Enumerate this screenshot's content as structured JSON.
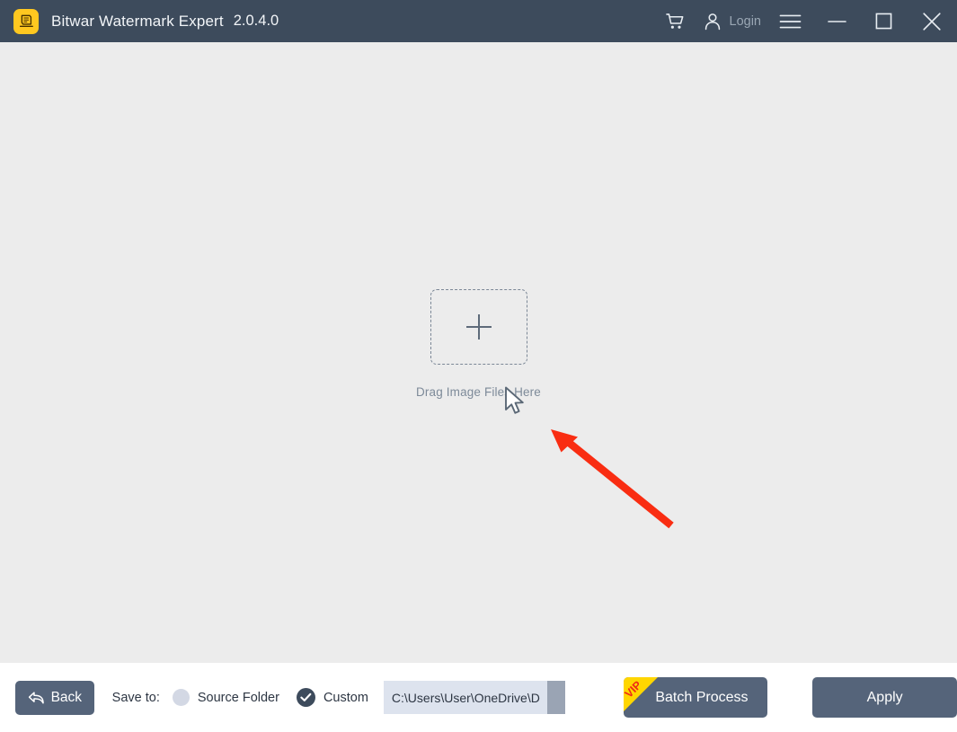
{
  "window": {
    "title": "Bitwar Watermark Expert",
    "version": "2.0.4.0",
    "app_icon": "bitwar-logo-icon"
  },
  "titlebar": {
    "cart_icon": "shopping-cart-icon",
    "account_icon": "user-account-icon",
    "login_label": "Login",
    "menu_icon": "hamburger-menu-icon",
    "minimize_icon": "minimize-icon",
    "maximize_icon": "maximize-icon",
    "close_icon": "close-icon"
  },
  "main": {
    "dropzone": {
      "plus_icon": "plus-icon",
      "label": "Drag Image Files Here"
    },
    "cursor_icon": "mouse-pointer-icon",
    "annotation_arrow_icon": "red-arrow-annotation-icon",
    "annotation_arrow_color": "#f92d12",
    "background_color": "#ececec"
  },
  "bottombar": {
    "back_label": "Back",
    "back_icon": "undo-arrow-icon",
    "save_to_label": "Save to:",
    "options": [
      {
        "label": "Source Folder",
        "selected": false
      },
      {
        "label": "Custom",
        "selected": true
      }
    ],
    "path_value": "C:\\Users\\User\\OneDrive\\D",
    "path_scroll_icon": "scroll-handle-icon",
    "batch_label": "Batch Process",
    "batch_badge": "VIP",
    "apply_label": "Apply",
    "button_color": "#55647a",
    "badge_color": "#ffd600",
    "badge_text_color": "#ee2b16"
  }
}
